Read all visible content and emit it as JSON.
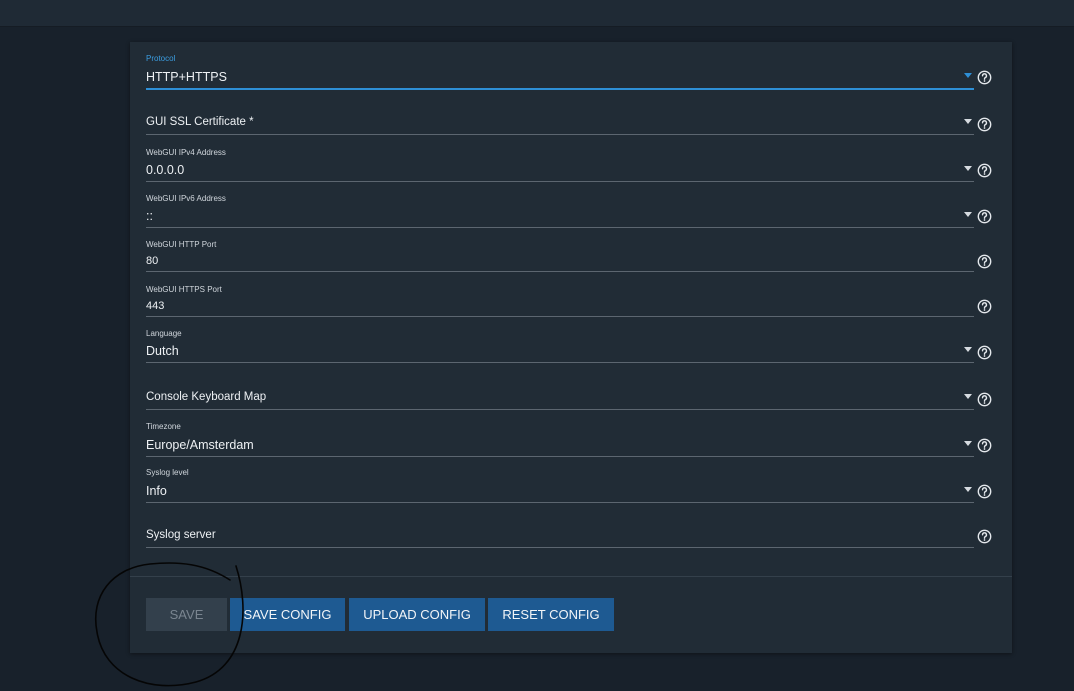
{
  "fields": [
    {
      "label": "Protocol",
      "value": "HTTP+HTTPS"
    },
    {
      "label": "",
      "value": "GUI SSL Certificate *"
    },
    {
      "label": "WebGUI IPv4 Address",
      "value": "0.0.0.0"
    },
    {
      "label": "WebGUI IPv6 Address",
      "value": "::"
    },
    {
      "label": "WebGUI HTTP Port",
      "value": "80"
    },
    {
      "label": "WebGUI HTTPS Port",
      "value": "443"
    },
    {
      "label": "Language",
      "value": "Dutch"
    },
    {
      "label": "",
      "value": "Console Keyboard Map"
    },
    {
      "label": "Timezone",
      "value": "Europe/Amsterdam"
    },
    {
      "label": "Syslog level",
      "value": "Info"
    },
    {
      "label": "",
      "value": "Syslog server"
    }
  ],
  "buttons": {
    "save": "SAVE",
    "save_config": "SAVE CONFIG",
    "upload_config": "UPLOAD CONFIG",
    "reset_config": "RESET CONFIG"
  },
  "colors": {
    "accent": "#2e8fd6",
    "button": "#1e5a92",
    "button_disabled": "#33404c"
  },
  "icons": {
    "help": "help-circle-icon",
    "dropdown": "chevron-down-icon"
  }
}
